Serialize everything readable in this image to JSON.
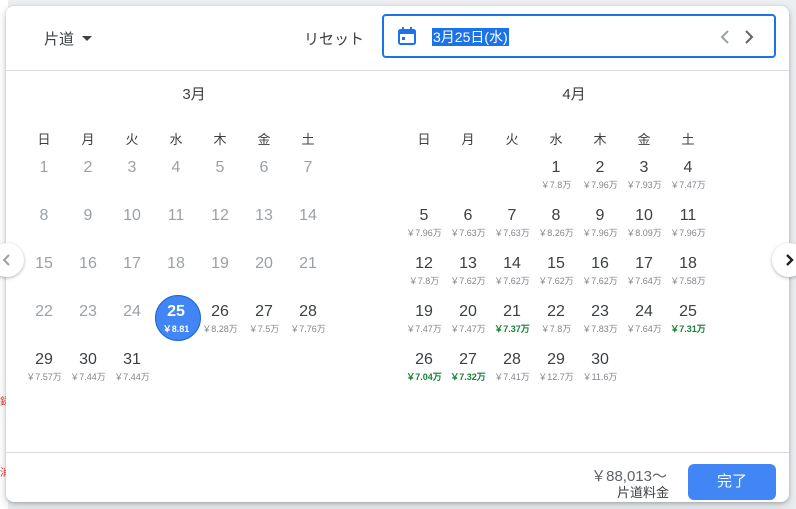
{
  "background": {
    "left_marks": [
      "録",
      "消"
    ]
  },
  "header": {
    "trip_type": "片道",
    "reset_label": "リセット",
    "selected_date": "3月25日(水)"
  },
  "weekdays": [
    "日",
    "月",
    "火",
    "水",
    "木",
    "金",
    "土"
  ],
  "march": {
    "title": "3月",
    "days": [
      {
        "d": "1"
      },
      {
        "d": "2"
      },
      {
        "d": "3"
      },
      {
        "d": "4"
      },
      {
        "d": "5"
      },
      {
        "d": "6"
      },
      {
        "d": "7"
      },
      {
        "d": "8"
      },
      {
        "d": "9"
      },
      {
        "d": "10"
      },
      {
        "d": "11"
      },
      {
        "d": "12"
      },
      {
        "d": "13"
      },
      {
        "d": "14"
      },
      {
        "d": "15"
      },
      {
        "d": "16"
      },
      {
        "d": "17"
      },
      {
        "d": "18"
      },
      {
        "d": "19"
      },
      {
        "d": "20"
      },
      {
        "d": "21"
      },
      {
        "d": "22"
      },
      {
        "d": "23"
      },
      {
        "d": "24"
      },
      {
        "d": "25",
        "p": "￥8.81"
      },
      {
        "d": "26",
        "p": "￥8.28万"
      },
      {
        "d": "27",
        "p": "￥7.5万"
      },
      {
        "d": "28",
        "p": "￥7.76万"
      },
      {
        "d": "29",
        "p": "￥7.57万"
      },
      {
        "d": "30",
        "p": "￥7.44万"
      },
      {
        "d": "31",
        "p": "￥7.44万"
      }
    ]
  },
  "april": {
    "title": "4月",
    "days": [
      {
        "d": "1",
        "p": "￥7.8万"
      },
      {
        "d": "2",
        "p": "￥7.96万"
      },
      {
        "d": "3",
        "p": "￥7.93万"
      },
      {
        "d": "4",
        "p": "￥7.47万"
      },
      {
        "d": "5",
        "p": "￥7.96万"
      },
      {
        "d": "6",
        "p": "￥7.63万"
      },
      {
        "d": "7",
        "p": "￥7.63万"
      },
      {
        "d": "8",
        "p": "￥8.26万"
      },
      {
        "d": "9",
        "p": "￥7.96万"
      },
      {
        "d": "10",
        "p": "￥8.09万"
      },
      {
        "d": "11",
        "p": "￥7.96万"
      },
      {
        "d": "12",
        "p": "￥7.8万"
      },
      {
        "d": "13",
        "p": "￥7.62万"
      },
      {
        "d": "14",
        "p": "￥7.62万"
      },
      {
        "d": "15",
        "p": "￥7.62万"
      },
      {
        "d": "16",
        "p": "￥7.62万"
      },
      {
        "d": "17",
        "p": "￥7.64万"
      },
      {
        "d": "18",
        "p": "￥7.58万"
      },
      {
        "d": "19",
        "p": "￥7.47万"
      },
      {
        "d": "20",
        "p": "￥7.47万"
      },
      {
        "d": "21",
        "p": "￥7.37万",
        "c": true
      },
      {
        "d": "22",
        "p": "￥7.8万"
      },
      {
        "d": "23",
        "p": "￥7.83万"
      },
      {
        "d": "24",
        "p": "￥7.64万"
      },
      {
        "d": "25",
        "p": "￥7.31万",
        "c": true
      },
      {
        "d": "26",
        "p": "￥7.04万",
        "c": true
      },
      {
        "d": "27",
        "p": "￥7.32万",
        "c": true
      },
      {
        "d": "28",
        "p": "￥7.41万"
      },
      {
        "d": "29",
        "p": "￥12.7万"
      },
      {
        "d": "30",
        "p": "￥11.6万"
      }
    ]
  },
  "footer": {
    "total_price": "￥88,013～",
    "total_label": "片道料金",
    "done_label": "完了"
  },
  "colors": {
    "accent": "#1a73e8",
    "selected": "#4285f4",
    "cheap": "#188038"
  }
}
